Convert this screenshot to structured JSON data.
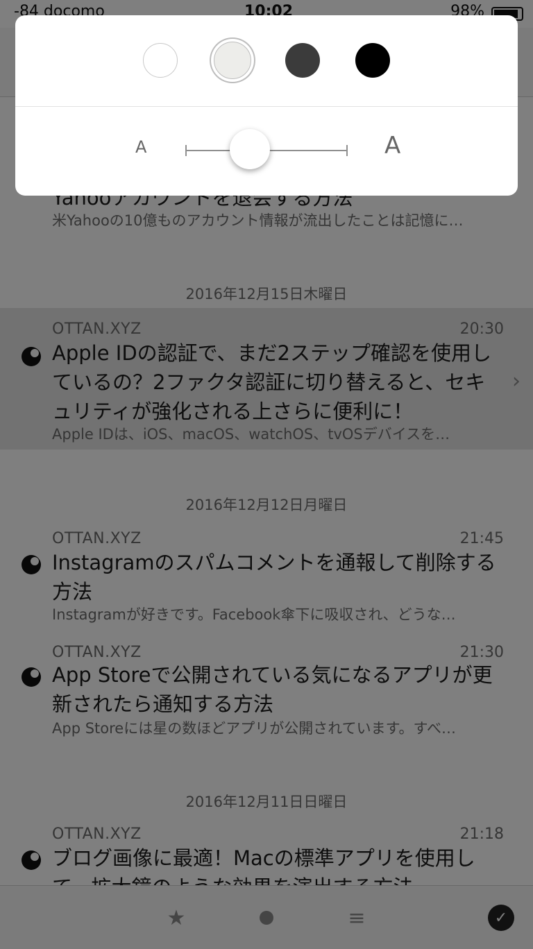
{
  "status_bar": {
    "carrier": "-84 docomo",
    "time": "10:02",
    "battery": "98%"
  },
  "appearance_popover": {
    "themes": [
      "white",
      "sepia",
      "dark-gray",
      "black"
    ],
    "selected_theme": "sepia",
    "theme_colors": {
      "white": "#ffffff",
      "sepia": "#ededea",
      "dark-gray": "#3b3b3b",
      "black": "#000000"
    },
    "font_size_small_label": "A",
    "font_size_large_label": "A",
    "font_size_level": 0.5
  },
  "articles_top": {
    "title": "Yahooアカウントを退会する方法",
    "excerpt": "米Yahooの10億ものアカウント情報が流出したことは記憶に…"
  },
  "sections": [
    {
      "date": "2016年12月15日木曜日",
      "items": [
        {
          "source": "OTTAN.XYZ",
          "time": "20:30",
          "title": "Apple IDの認証で、まだ2ステップ確認を使用しているの？2ファクタ認証に切り替えると、セキュリティが強化される上さらに便利に！",
          "excerpt": "Apple IDは、iOS、macOS、watchOS、tvOSデバイスを…"
        }
      ]
    },
    {
      "date": "2016年12月12日月曜日",
      "items": [
        {
          "source": "OTTAN.XYZ",
          "time": "21:45",
          "title": "Instagramのスパムコメントを通報して削除する方法",
          "excerpt": "Instagramが好きです。Facebook傘下に吸収され、どうな…"
        },
        {
          "source": "OTTAN.XYZ",
          "time": "21:30",
          "title": "App Storeで公開されている気になるアプリが更新されたら通知する方法",
          "excerpt": "App Storeには星の数ほどアプリが公開されています。すべ…"
        }
      ]
    },
    {
      "date": "2016年12月11日日曜日",
      "items": [
        {
          "source": "OTTAN.XYZ",
          "time": "21:18",
          "title": "ブログ画像に最適！Macの標準アプリを使用して、拡大鏡のような効果を演出する方法",
          "excerpt": ""
        }
      ]
    }
  ],
  "tab_bar": {
    "icons": [
      "star-icon",
      "circle-icon",
      "list-icon",
      "checkmark-icon"
    ],
    "check_glyph": "✓",
    "star_glyph": "★",
    "list_glyph": "≡"
  }
}
